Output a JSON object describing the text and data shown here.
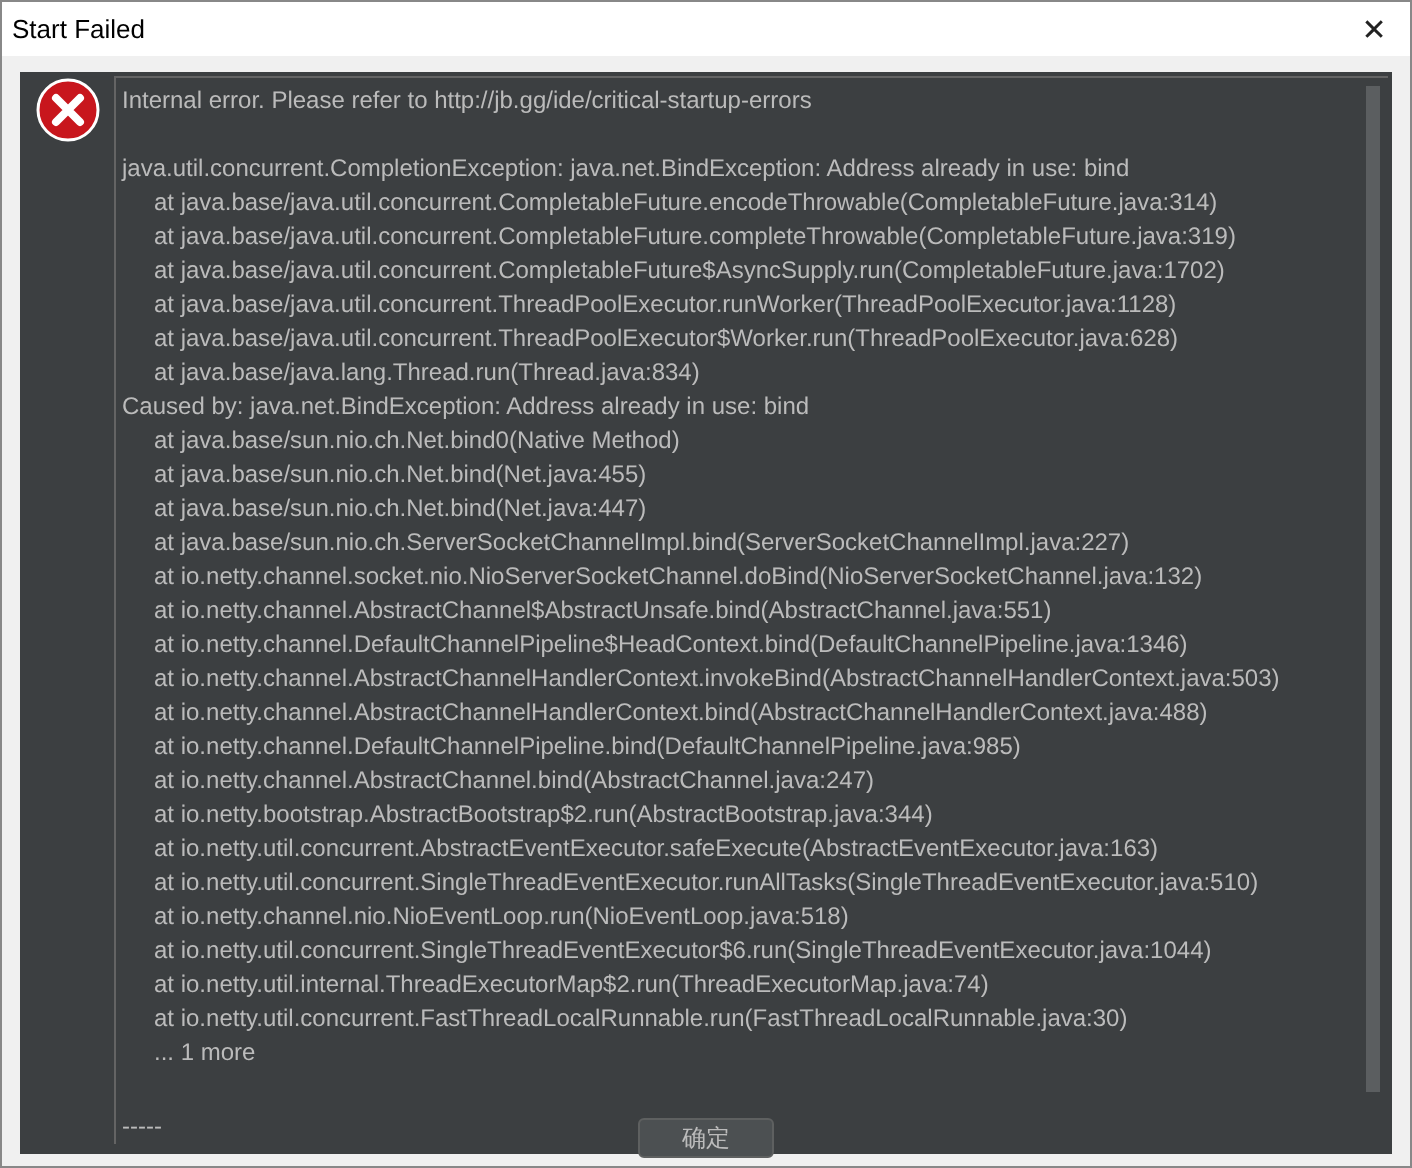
{
  "window": {
    "title": "Start Failed",
    "close": "✕"
  },
  "message": "Internal error. Please refer to http://jb.gg/ide/critical-startup-errors",
  "exceptions": [
    {
      "text": "java.util.concurrent.CompletionException: java.net.BindException: Address already in use: bind",
      "frames": [
        "at java.base/java.util.concurrent.CompletableFuture.encodeThrowable(CompletableFuture.java:314)",
        "at java.base/java.util.concurrent.CompletableFuture.completeThrowable(CompletableFuture.java:319)",
        "at java.base/java.util.concurrent.CompletableFuture$AsyncSupply.run(CompletableFuture.java:1702)",
        "at java.base/java.util.concurrent.ThreadPoolExecutor.runWorker(ThreadPoolExecutor.java:1128)",
        "at java.base/java.util.concurrent.ThreadPoolExecutor$Worker.run(ThreadPoolExecutor.java:628)",
        "at java.base/java.lang.Thread.run(Thread.java:834)"
      ]
    },
    {
      "text": "Caused by: java.net.BindException: Address already in use: bind",
      "frames": [
        "at java.base/sun.nio.ch.Net.bind0(Native Method)",
        "at java.base/sun.nio.ch.Net.bind(Net.java:455)",
        "at java.base/sun.nio.ch.Net.bind(Net.java:447)",
        "at java.base/sun.nio.ch.ServerSocketChannelImpl.bind(ServerSocketChannelImpl.java:227)",
        "at io.netty.channel.socket.nio.NioServerSocketChannel.doBind(NioServerSocketChannel.java:132)",
        "at io.netty.channel.AbstractChannel$AbstractUnsafe.bind(AbstractChannel.java:551)",
        "at io.netty.channel.DefaultChannelPipeline$HeadContext.bind(DefaultChannelPipeline.java:1346)",
        "at io.netty.channel.AbstractChannelHandlerContext.invokeBind(AbstractChannelHandlerContext.java:503)",
        "at io.netty.channel.AbstractChannelHandlerContext.bind(AbstractChannelHandlerContext.java:488)",
        "at io.netty.channel.DefaultChannelPipeline.bind(DefaultChannelPipeline.java:985)",
        "at io.netty.channel.AbstractChannel.bind(AbstractChannel.java:247)",
        "at io.netty.bootstrap.AbstractBootstrap$2.run(AbstractBootstrap.java:344)",
        "at io.netty.util.concurrent.AbstractEventExecutor.safeExecute(AbstractEventExecutor.java:163)",
        "at io.netty.util.concurrent.SingleThreadEventExecutor.runAllTasks(SingleThreadEventExecutor.java:510)",
        "at io.netty.channel.nio.NioEventLoop.run(NioEventLoop.java:518)",
        "at io.netty.util.concurrent.SingleThreadEventExecutor$6.run(SingleThreadEventExecutor.java:1044)",
        "at io.netty.util.internal.ThreadExecutorMap$2.run(ThreadExecutorMap.java:74)",
        "at io.netty.util.concurrent.FastThreadLocalRunnable.run(FastThreadLocalRunnable.java:30)",
        "... 1 more"
      ]
    }
  ],
  "separator": "-----",
  "buttons": [
    "确定"
  ]
}
